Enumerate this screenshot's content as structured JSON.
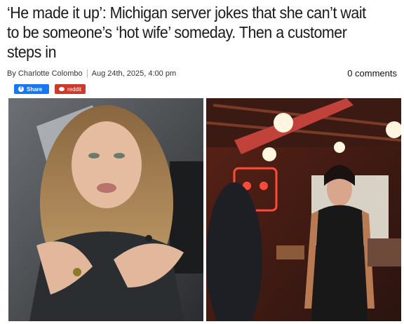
{
  "article": {
    "headline": "‘He made it up’: Michigan server jokes that she can’t wait to be someone’s ‘hot wife’ someday. Then a customer steps in",
    "byline_prefix": "By",
    "author": "Charlotte Colombo",
    "date": "Aug 24th, 2025, 4:00 pm",
    "comments": "0 comments"
  },
  "share": {
    "facebook_label": "Share",
    "facebook_icon": "facebook-icon",
    "reddit_label": "reddit",
    "reddit_icon": "reddit-icon"
  },
  "colors": {
    "facebook": "#1877f2",
    "reddit": "#cc3a2b"
  },
  "images": {
    "left": "woman-in-car-selfie-photo",
    "right": "server-in-restaurant-photo"
  }
}
